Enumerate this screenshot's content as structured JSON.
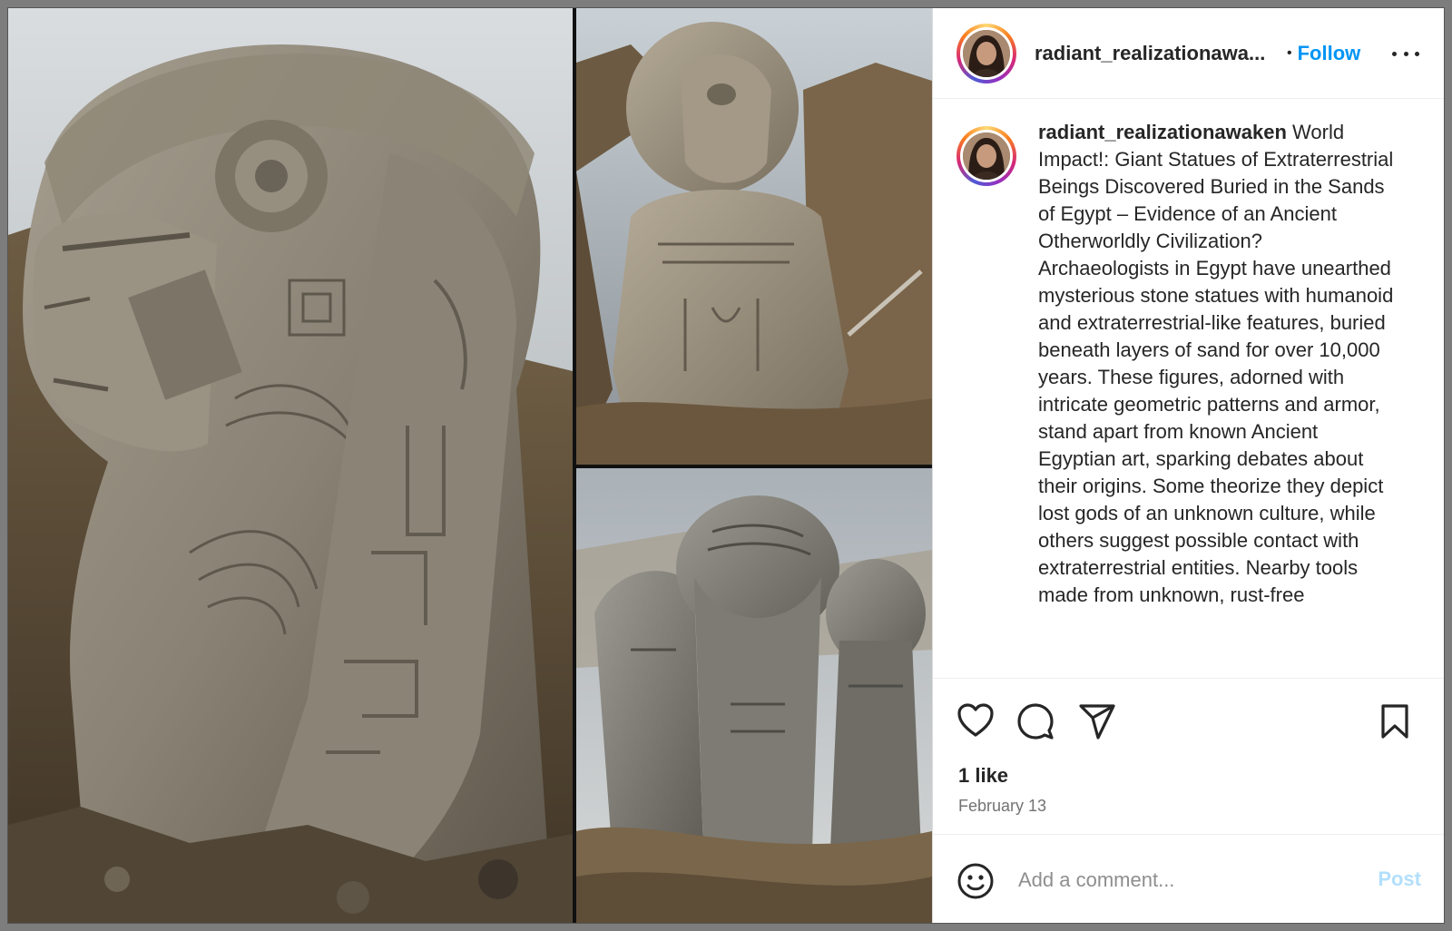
{
  "post": {
    "username": "radiant_realizationawa...",
    "separator": "•",
    "follow_label": "Follow",
    "more_icon": "more-options-icon"
  },
  "caption": {
    "username": "radiant_realizationawaken",
    "text": "World Impact!: Giant Statues of Extraterrestrial Beings Discovered Buried in the Sands of Egypt – Evidence of an Ancient Otherworldly Civilization?",
    "body": "Archaeologists in Egypt have unearthed mysterious stone statues with humanoid and extraterrestrial-like features, buried beneath layers of sand for over 10,000 years. These figures, adorned with intricate geometric patterns and armor, stand apart from known Ancient Egyptian art, sparking debates about their origins. Some theorize they depict lost gods of an unknown culture, while others suggest possible contact with extraterrestrial entities. Nearby tools made from unknown, rust-free"
  },
  "actions": {
    "like_icon": "heart-icon",
    "comment_icon": "comment-icon",
    "share_icon": "send-icon",
    "save_icon": "bookmark-icon"
  },
  "stats": {
    "likes": "1 like",
    "date": "February 13"
  },
  "comment": {
    "emoji_icon": "emoji-icon",
    "placeholder": "Add a comment...",
    "post_label": "Post"
  },
  "colors": {
    "follow": "#0095f6",
    "post_disabled": "#b2dffc",
    "text": "#262626",
    "muted": "#737373"
  }
}
